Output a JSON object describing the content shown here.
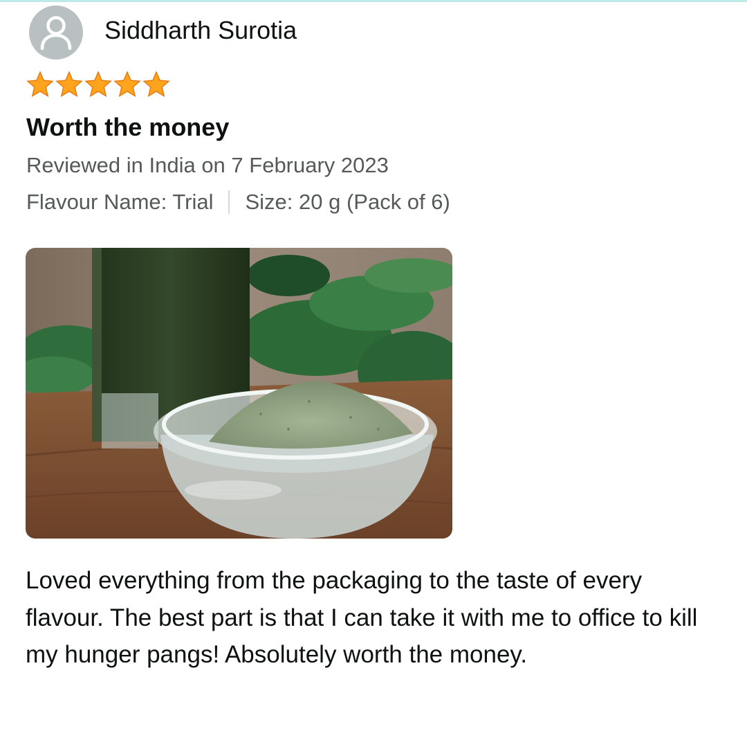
{
  "reviewer": {
    "name": "Siddharth Surotia",
    "avatar_icon": "default-user-icon"
  },
  "rating": {
    "value": 5,
    "max": 5,
    "star_color": "#ffa41c"
  },
  "review": {
    "title": "Worth the money",
    "date_line": "Reviewed in India on 7 February 2023",
    "flavour": "Flavour Name: Trial",
    "size": "Size: 20 g (Pack of 6)",
    "body": "Loved everything from the packaging to the taste of every flavour. The best part is that I can take it with me to office to kill my hunger pangs! Absolutely worth the money."
  },
  "photo": {
    "subject": "green-powder-bowl-and-drink-photo"
  }
}
